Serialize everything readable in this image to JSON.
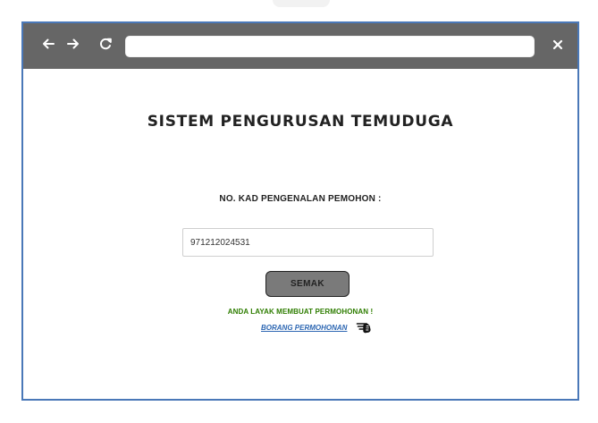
{
  "browser": {
    "url": "",
    "icons": {
      "back": "arrow-left-icon",
      "forward": "arrow-right-icon",
      "reload": "reload-icon",
      "close": "close-icon"
    }
  },
  "page": {
    "title": "SISTEM PENGURUSAN TEMUDUGA",
    "ic_label": "NO. KAD PENGENALAN PEMOHON :",
    "ic_value": "971212024531",
    "check_button_label": "SEMAK",
    "eligible_message": "ANDA LAYAK MEMBUAT PERMOHONAN !",
    "form_link_label": "BORANG PERMOHONAN",
    "form_link_icon": "pointing-hand-icon"
  },
  "colors": {
    "toolbar": "#666666",
    "window_border": "#4a78b8",
    "success_text": "#2e7d00",
    "link_text": "#2c66b2",
    "button_fill": "#7a7a7a"
  }
}
